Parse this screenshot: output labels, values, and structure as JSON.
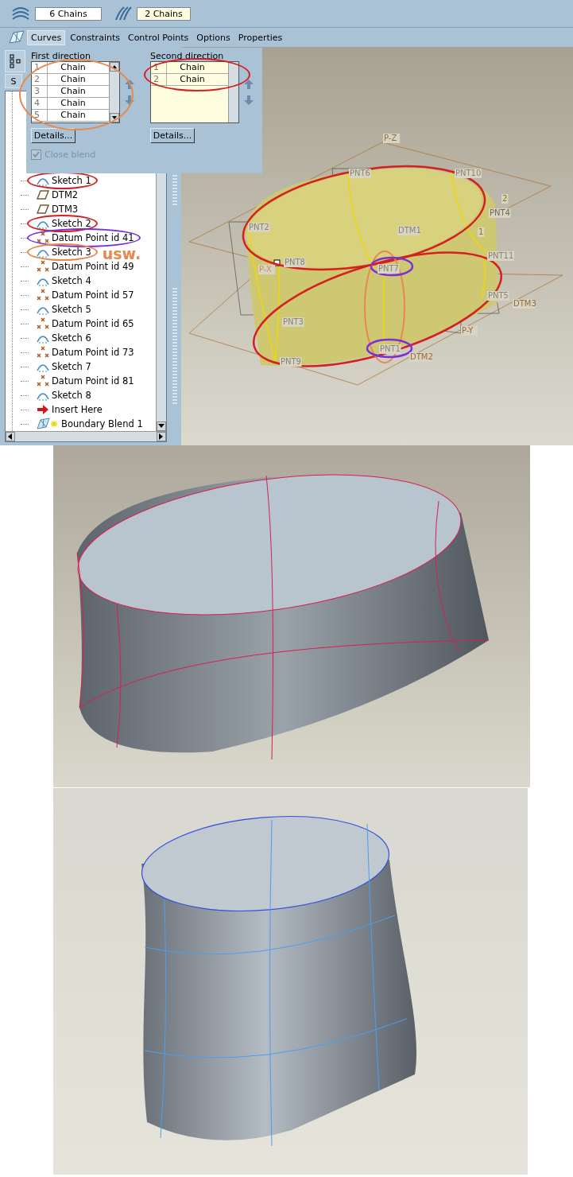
{
  "toolbar": {
    "first_chains": "6 Chains",
    "second_chains": "2 Chains"
  },
  "tabs": [
    {
      "label": "Curves",
      "selected": true
    },
    {
      "label": "Constraints",
      "selected": false
    },
    {
      "label": "Control Points",
      "selected": false
    },
    {
      "label": "Options",
      "selected": false
    },
    {
      "label": "Properties",
      "selected": false
    }
  ],
  "side_tab": {
    "label": "S"
  },
  "panel": {
    "first_direction": {
      "title": "First direction",
      "color": "#e8884a",
      "rows": [
        {
          "number": "1",
          "name": "Chain"
        },
        {
          "number": "2",
          "name": "Chain"
        },
        {
          "number": "3",
          "name": "Chain"
        },
        {
          "number": "4",
          "name": "Chain"
        },
        {
          "number": "5",
          "name": "Chain"
        }
      ],
      "details": "Details..."
    },
    "second_direction": {
      "title": "Second direction",
      "color": "#d42020",
      "rows": [
        {
          "number": "1",
          "name": "Chain"
        },
        {
          "number": "2",
          "name": "Chain"
        }
      ],
      "details": "Details..."
    },
    "close_blend": {
      "label": "Close blend",
      "checked": true,
      "disabled": true
    }
  },
  "tree": {
    "items": [
      {
        "kind": "sketch",
        "label": "Sketch 1",
        "color": "#d42020"
      },
      {
        "kind": "plane",
        "label": "DTM2"
      },
      {
        "kind": "plane",
        "label": "DTM3"
      },
      {
        "kind": "sketch",
        "label": "Sketch 2",
        "color": "#d42020"
      },
      {
        "kind": "point",
        "label": "Datum Point id 41",
        "color": "#7a30d8"
      },
      {
        "kind": "sketch",
        "label": "Sketch 3",
        "color": "#e8884a",
        "note": "usw."
      },
      {
        "kind": "point",
        "label": "Datum Point id 49"
      },
      {
        "kind": "sketch",
        "label": "Sketch 4"
      },
      {
        "kind": "point",
        "label": "Datum Point id 57"
      },
      {
        "kind": "sketch",
        "label": "Sketch 5"
      },
      {
        "kind": "point",
        "label": "Datum Point id 65"
      },
      {
        "kind": "sketch",
        "label": "Sketch 6"
      },
      {
        "kind": "point",
        "label": "Datum Point id 73"
      },
      {
        "kind": "sketch",
        "label": "Sketch 7"
      },
      {
        "kind": "point",
        "label": "Datum Point id 81"
      },
      {
        "kind": "sketch",
        "label": "Sketch 8"
      },
      {
        "kind": "insert",
        "label": "Insert Here"
      },
      {
        "kind": "blend",
        "label": "Boundary Blend 1"
      }
    ]
  },
  "viewport": {
    "labels": [
      "P-Z",
      "PNT6",
      "PNT10",
      "PNT2",
      "DTM1",
      "2",
      "PNT4",
      "1",
      "PNT8",
      "P-X",
      "PNT7",
      "PNT11",
      "PNT5",
      "DTM3",
      "PNT3",
      "P-Y",
      "PNT1",
      "DTM2",
      "PNT9"
    ]
  }
}
